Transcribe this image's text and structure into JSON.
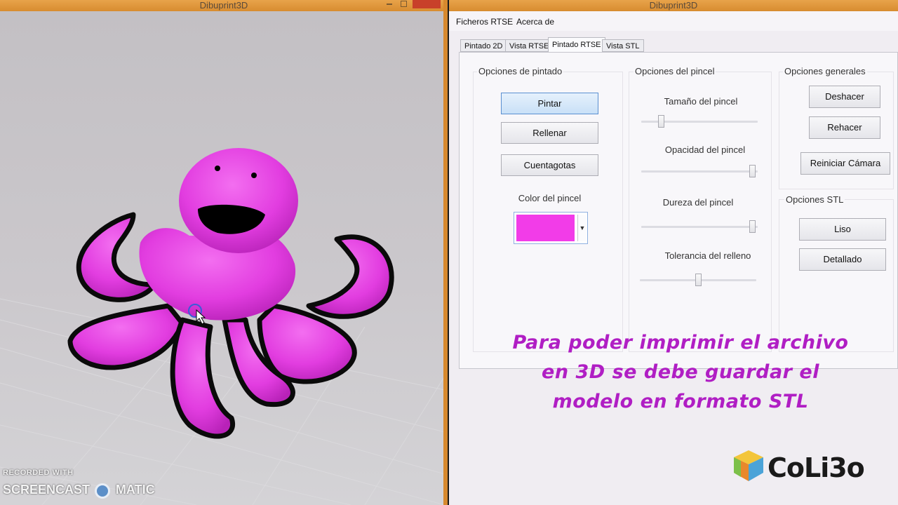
{
  "windows": {
    "left_title": "Dibuprint3D",
    "right_title": "Dibuprint3D"
  },
  "menu": [
    "Ficheros RTSE",
    "Acerca de"
  ],
  "tabs": [
    {
      "label": "Pintado 2D",
      "active": false
    },
    {
      "label": "Vista RTSE",
      "active": false
    },
    {
      "label": "Pintado RTSE",
      "active": true
    },
    {
      "label": "Vista STL",
      "active": false
    }
  ],
  "painting_options": {
    "title": "Opciones de pintado",
    "buttons": [
      "Pintar",
      "Rellenar",
      "Cuentagotas"
    ],
    "selected": "Pintar",
    "brush_color_label": "Color del pincel",
    "brush_color": "#f23ce8"
  },
  "brush_options": {
    "title": "Opciones del pincel",
    "sliders": [
      {
        "label": "Tamaño del pincel",
        "value": 0.15
      },
      {
        "label": "Opacidad del pincel",
        "value": 0.98
      },
      {
        "label": "Dureza del pincel",
        "value": 0.98
      },
      {
        "label": "Tolerancia del relleno",
        "value": 0.5
      }
    ]
  },
  "general_options": {
    "title": "Opciones generales",
    "buttons": [
      "Deshacer",
      "Rehacer",
      "Reiniciar Cámara"
    ]
  },
  "stl_options": {
    "title": "Opciones STL",
    "buttons": [
      "Liso",
      "Detallado"
    ]
  },
  "caption": [
    "Para poder imprimir el archivo",
    "en 3D se debe guardar el",
    "modelo en formato STL"
  ],
  "logo": {
    "text": "CoLi3o"
  },
  "watermark": {
    "line1": "RECORDED WITH",
    "line2": "SCREENCAST",
    "line2b": "MATIC"
  },
  "colors": {
    "model_pink": "#e23de0",
    "caption": "#b01ec4",
    "accent_title": "#d88c30"
  }
}
